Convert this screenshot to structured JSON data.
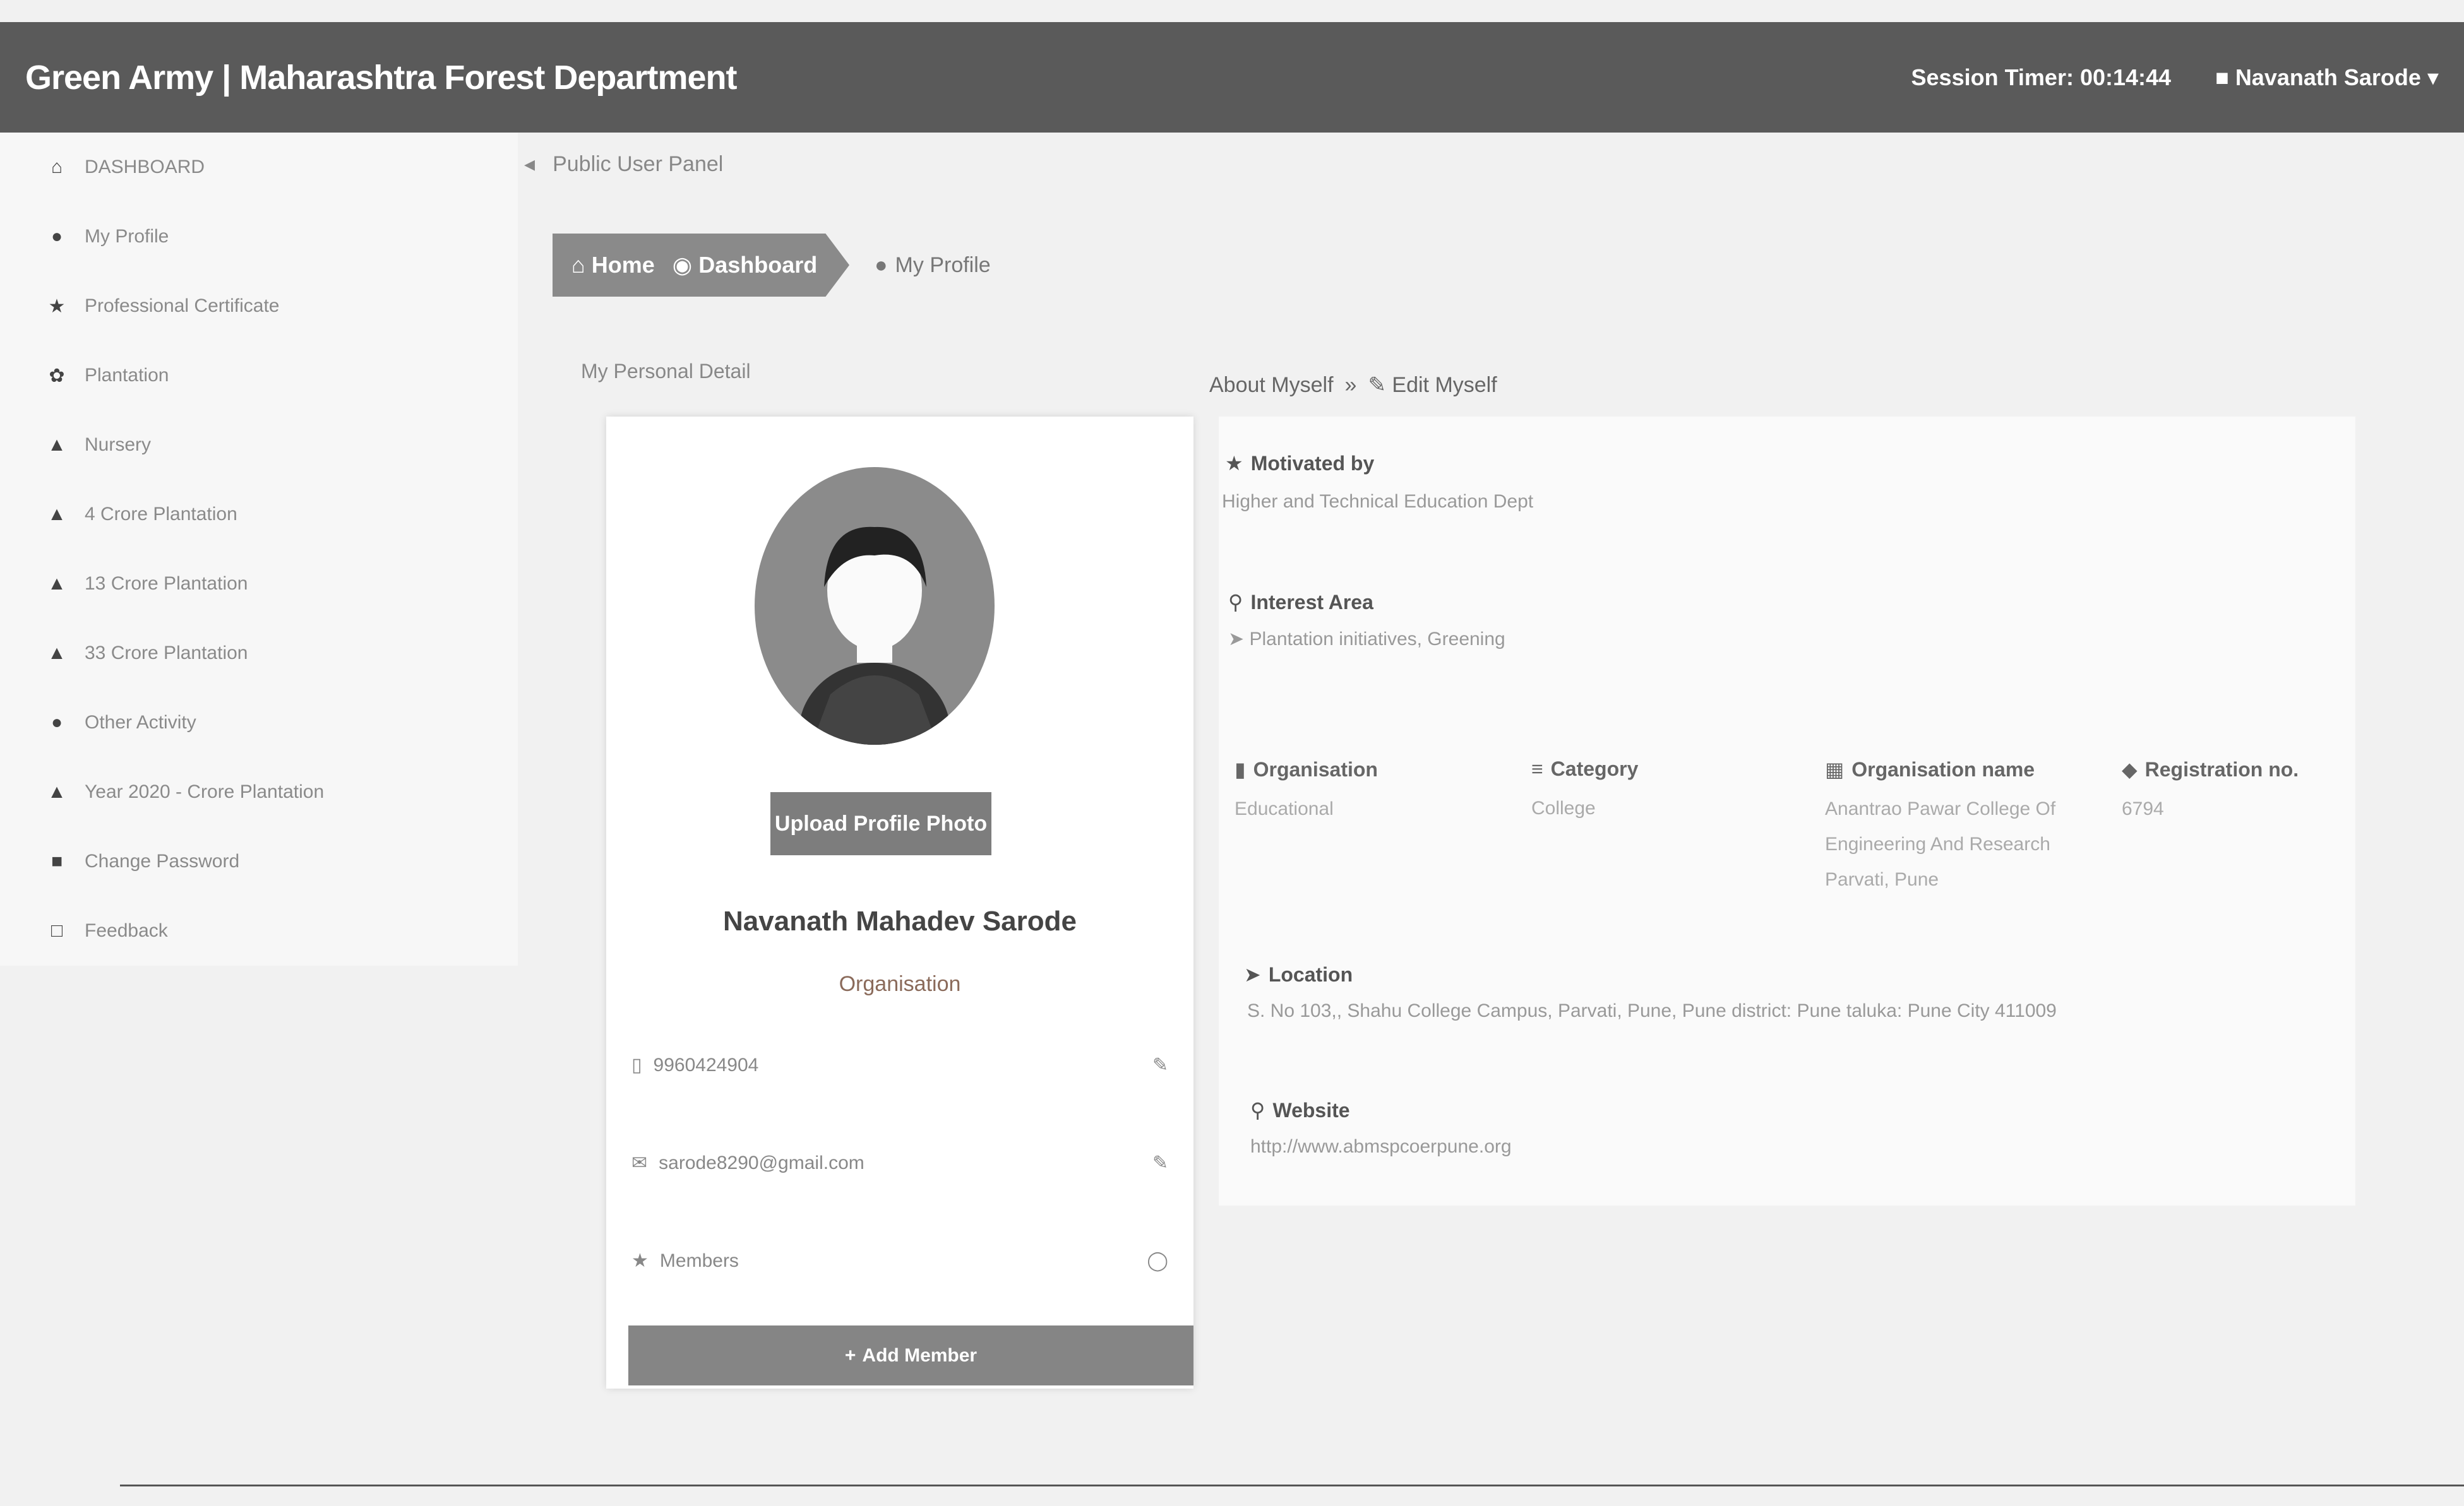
{
  "header": {
    "title": "Green Army | Maharashtra Forest Department",
    "session_timer": "Session Timer: 00:14:44",
    "user_name": "Navanath Sarode"
  },
  "sidebar": {
    "items": [
      {
        "label": "DASHBOARD",
        "icon": "home-icon"
      },
      {
        "label": "My Profile",
        "icon": "user-icon"
      },
      {
        "label": "Professional Certificate",
        "icon": "certificate-icon"
      },
      {
        "label": "Plantation",
        "icon": "leaf-icon"
      },
      {
        "label": "Nursery",
        "icon": "tree-icon"
      },
      {
        "label": "4 Crore Plantation",
        "icon": "tree-icon"
      },
      {
        "label": "13 Crore Plantation",
        "icon": "tree-icon"
      },
      {
        "label": "33 Crore Plantation",
        "icon": "tree-icon"
      },
      {
        "label": "Other Activity",
        "icon": "pin-icon"
      },
      {
        "label": "Year 2020 - Crore Plantation",
        "icon": "tree-icon"
      },
      {
        "label": "Change Password",
        "icon": "lock-icon"
      },
      {
        "label": "Feedback",
        "icon": "comment-icon"
      }
    ]
  },
  "page": {
    "title": "Public User Panel",
    "breadcrumb": {
      "home": "Home",
      "dashboard": "Dashboard",
      "current": "My Profile"
    },
    "section_label": "My Personal Detail"
  },
  "profile": {
    "upload_button": "Upload Profile Photo",
    "name": "Navanath Mahadev Sarode",
    "type": "Organisation",
    "phone": "9960424904",
    "email": "sarode8290@gmail.com",
    "members_label": "Members",
    "add_member_button": "Add Member"
  },
  "about": {
    "title": "About Myself",
    "edit_link": "Edit Myself",
    "motivated_by": {
      "label": "Motivated by",
      "value": "Higher and Technical Education Dept"
    },
    "interest_area": {
      "label": "Interest Area",
      "value": "Plantation initiatives, Greening"
    },
    "organisation": {
      "label": "Organisation",
      "value": "Educational"
    },
    "category": {
      "label": "Category",
      "value": "College"
    },
    "organisation_name": {
      "label": "Organisation name",
      "value": "Anantrao Pawar College Of Engineering And Research Parvati, Pune"
    },
    "registration_no": {
      "label": "Registration no.",
      "value": "6794"
    },
    "location": {
      "label": "Location",
      "value": "S. No 103,, Shahu College Campus, Parvati, Pune, Pune  district: Pune  taluka: Pune City  411009"
    },
    "website": {
      "label": "Website",
      "value": "http://www.abmspcoerpune.org"
    }
  }
}
